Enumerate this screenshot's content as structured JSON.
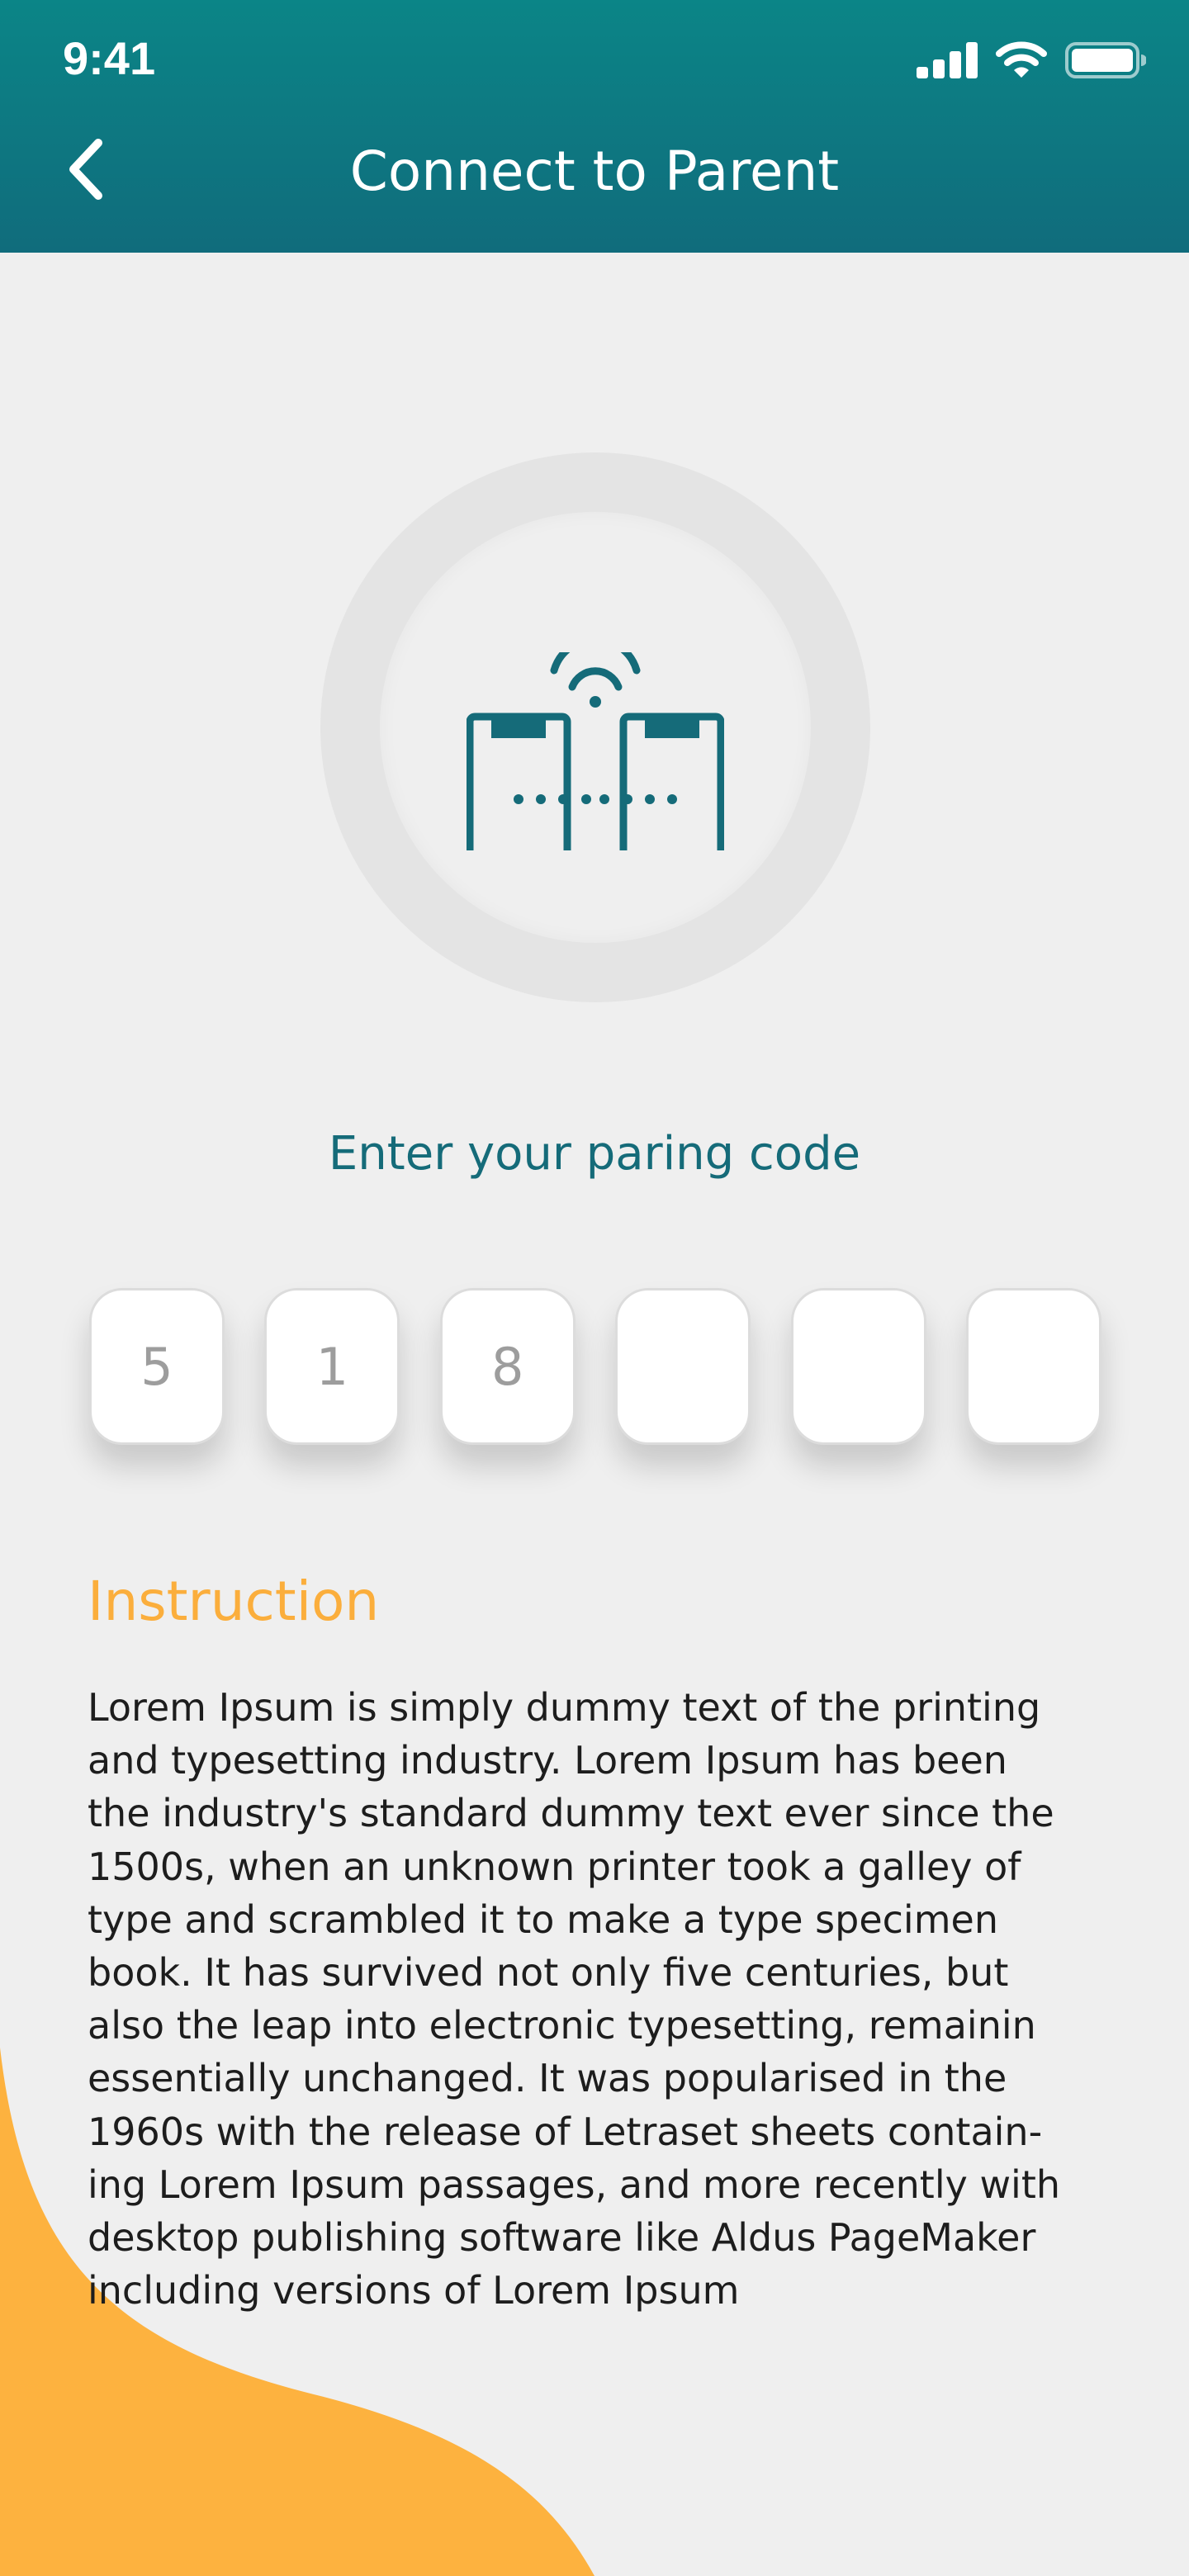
{
  "status_bar": {
    "time": "9:41"
  },
  "header": {
    "title": "Connect to Parent"
  },
  "pairing": {
    "prompt": "Enter your paring code",
    "code_digits": [
      "5",
      "1",
      "8",
      "",
      "",
      ""
    ]
  },
  "instruction": {
    "title": "Instruction",
    "lines": [
      "Lorem Ipsum is simply dummy text of the printing",
      "and typesetting industry. Lorem Ipsum has been",
      "the industry's standard dummy text ever since the",
      "1500s, when an unknown printer took a galley of",
      "type and scrambled it to make a type specimen",
      "book. It has survived not only five centuries, but",
      "also the leap into electronic typesetting, remainin",
      "essentially unchanged. It was popularised in the",
      "1960s with the release of Letraset sheets contain-",
      "ing Lorem Ipsum passages, and more recently with",
      "desktop publishing software like Aldus PageMaker",
      "including versions of Lorem Ipsum"
    ]
  },
  "icons": {
    "back": "chevron-left-icon",
    "signal": "cellular-signal-icon",
    "wifi": "wifi-icon",
    "battery": "battery-icon",
    "pairing": "phones-pairing-icon"
  },
  "colors": {
    "header_start": "#0b8587",
    "header_end": "#106c7c",
    "accent_teal": "#156b79",
    "accent_orange": "#fbae3c",
    "background": "#efefef"
  }
}
